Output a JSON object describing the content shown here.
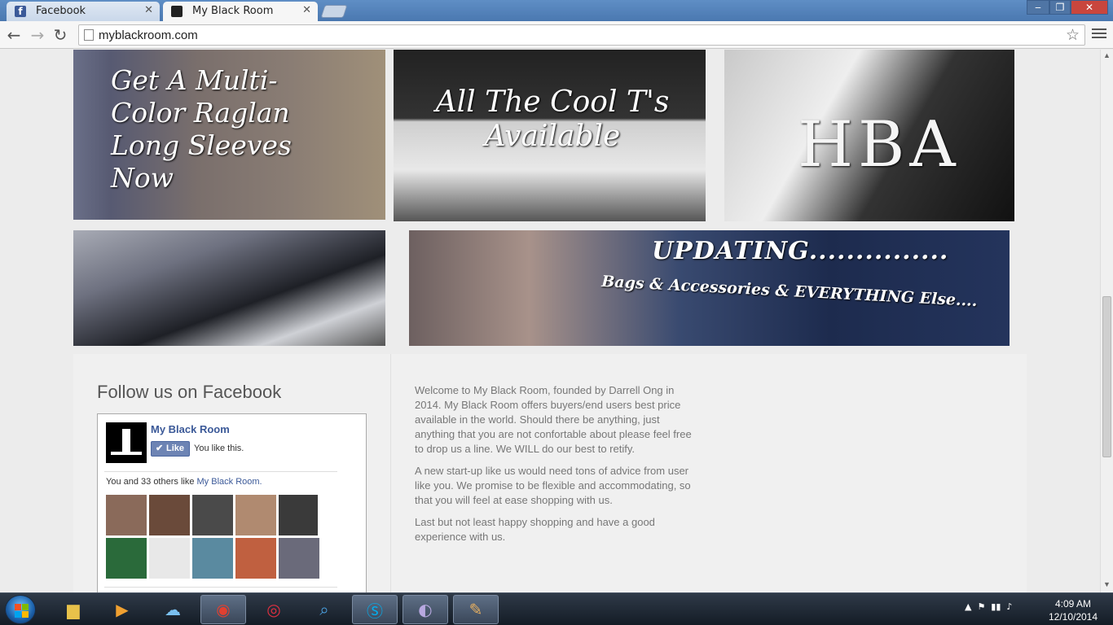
{
  "browser": {
    "tabs": [
      {
        "title": "Facebook",
        "active": false
      },
      {
        "title": "My Black Room",
        "active": true
      }
    ],
    "url": "myblackroom.com"
  },
  "banners": {
    "raglan": "Get A Multi-Color Raglan Long Sleeves Now",
    "tees": "All The Cool T's Available",
    "hba": "HBA",
    "updating_title": "UPDATING...............",
    "updating_sub": "Bags & Accessories & EVERYTHING Else...."
  },
  "facebook_widget": {
    "heading": "Follow us on Facebook",
    "page_name": "My Black Room",
    "like_label": "Like",
    "you_like": "You like this.",
    "count_prefix": "You and 33 others like ",
    "count_page": "My Black Room.",
    "faces": [
      "#8a6a5a",
      "#6a4a3a",
      "#4a4a4a",
      "#b08a70",
      "#3a3a3a",
      "#2a6a3a",
      "#e8e8e8",
      "#5a8aa0",
      "#c06040",
      "#6a6a7a"
    ]
  },
  "about": {
    "p1": "Welcome to My Black Room, founded by Darrell Ong in 2014. My Black Room offers buyers/end users best price available in the world. Should there be anything, just anything that you are not confortable about please feel free to drop us a line. We WILL do our best to retify.",
    "p2": "A new start-up like us would need tons of advice from user like you. We promise to be flexible and accommodating, so that you will feel at ease shopping with us.",
    "p3": "Last but not least happy shopping and have a good experience with us."
  },
  "taskbar": {
    "time": "4:09 AM",
    "date": "12/10/2014"
  }
}
